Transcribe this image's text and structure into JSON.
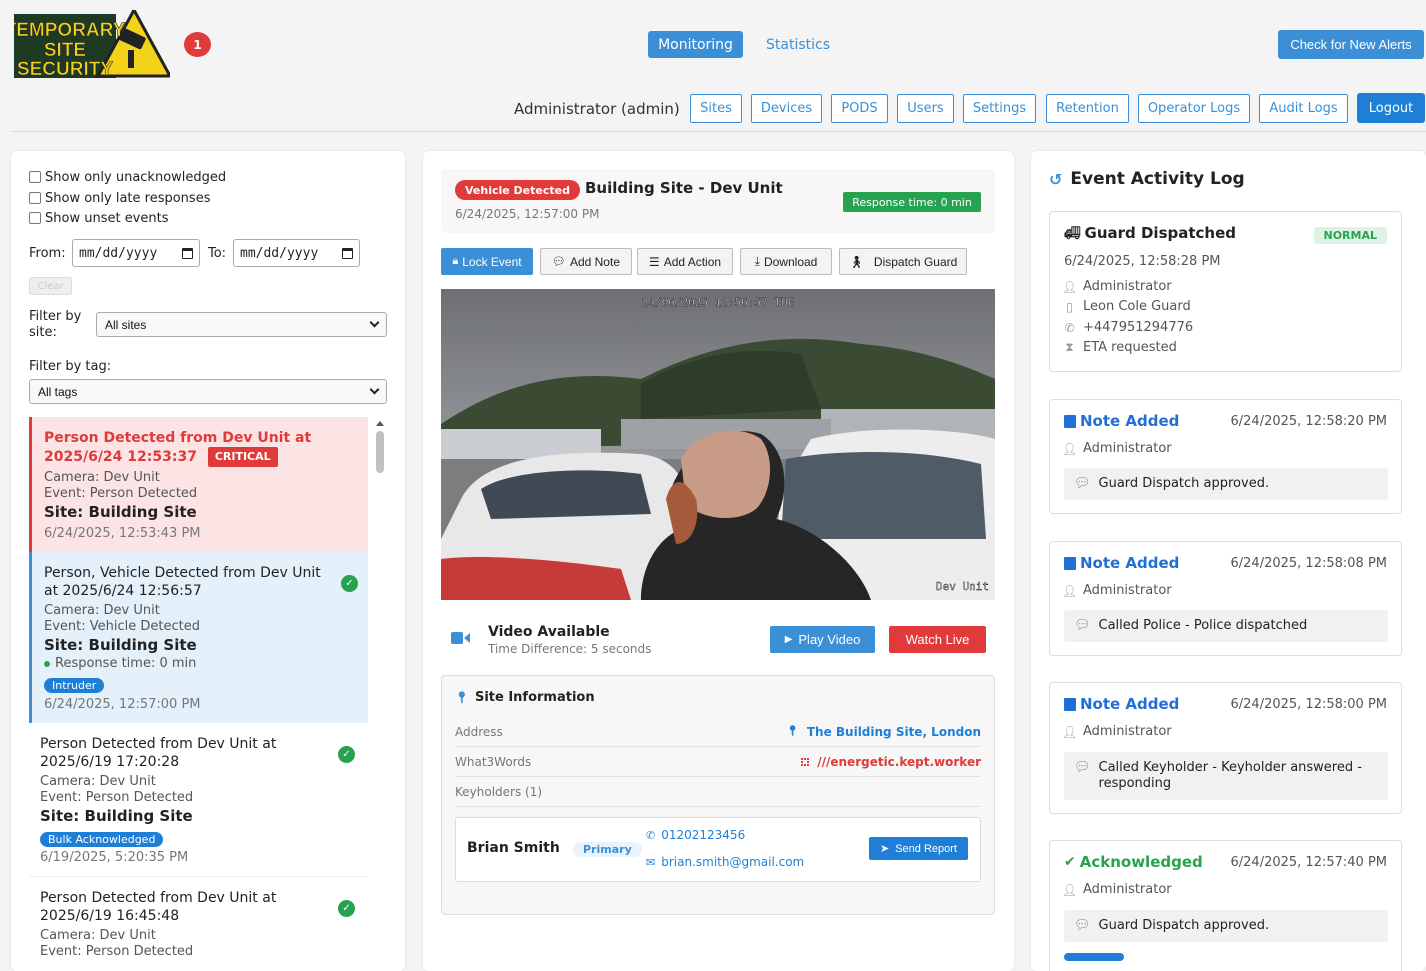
{
  "header": {
    "logo_lines": [
      "TEMPORARY",
      "SITE",
      "SECURITY"
    ],
    "notification_count": "1",
    "tabs": {
      "monitoring": "Monitoring",
      "statistics": "Statistics"
    },
    "check_alerts": "Check for New Alerts",
    "user_label": "Administrator (admin)",
    "nav": {
      "sites": "Sites",
      "devices": "Devices",
      "pods": "PODS",
      "users": "Users",
      "settings": "Settings",
      "retention": "Retention",
      "operator_logs": "Operator Logs",
      "audit_logs": "Audit Logs",
      "logout": "Logout"
    }
  },
  "filters": {
    "unacknowledged": "Show only unacknowledged",
    "late": "Show only late responses",
    "unset": "Show unset events",
    "from_label": "From:",
    "to_label": "To:",
    "date_placeholder": "mm/dd/yyyy",
    "clear": "Clear",
    "site_label": "Filter by site:",
    "site_value": "All sites",
    "tag_label": "Filter by tag:",
    "tag_value": "All tags"
  },
  "events": [
    {
      "title": "Person Detected from Dev Unit at 2025/6/24 12:53:37",
      "severity": "CRITICAL",
      "camera": "Camera: Dev Unit",
      "event": "Event: Person Detected",
      "site": "Site: Building Site",
      "time": "6/24/2025, 12:53:43 PM"
    },
    {
      "title": "Person, Vehicle Detected from Dev Unit at 2025/6/24 12:56:57",
      "camera": "Camera: Dev Unit",
      "event": "Event: Vehicle Detected",
      "site": "Site: Building Site",
      "response": "Response time: 0 min",
      "tag": "Intruder",
      "time": "6/24/2025, 12:57:00 PM"
    },
    {
      "title": "Person Detected from Dev Unit at 2025/6/19 17:20:28",
      "camera": "Camera: Dev Unit",
      "event": "Event: Person Detected",
      "site": "Site: Building Site",
      "tag": "Bulk Acknowledged",
      "time": "6/19/2025, 5:20:35 PM"
    },
    {
      "title": "Person Detected from Dev Unit at 2025/6/19 16:45:48",
      "camera": "Camera: Dev Unit",
      "event": "Event: Person Detected"
    }
  ],
  "detail": {
    "badge": "Vehicle Detected",
    "title": "Building Site - Dev Unit",
    "date": "6/24/2025, 12:57:00 PM",
    "response": "Response time: 0 min",
    "actions": {
      "lock": "Lock Event",
      "note": "Add Note",
      "action": "Add Action",
      "download": "Download",
      "dispatch": "Dispatch Guard"
    },
    "camera": {
      "timestamp": "24/06/2025 12:56:57 TUE",
      "label": "Dev Unit"
    },
    "video": {
      "title": "Video Available",
      "diff": "Time Difference: 5 seconds",
      "play": "Play Video",
      "live": "Watch Live"
    },
    "site_info": {
      "title": "Site Information",
      "address_label": "Address",
      "address": "The Building Site, London",
      "w3w_label": "What3Words",
      "w3w": "///energetic.kept.worker",
      "keyholders_label": "Keyholders (1)",
      "keyholder": {
        "name": "Brian Smith",
        "role": "Primary",
        "phone": "01202123456",
        "email": "brian.smith@gmail.com",
        "send": "Send Report"
      }
    }
  },
  "log": {
    "title": "Event Activity Log",
    "entries": [
      {
        "title": "Guard Dispatched",
        "badge": "NORMAL",
        "date": "6/24/2025, 12:58:28 PM",
        "lines": [
          "Administrator",
          "Leon Cole Guard",
          "+447951294776",
          "ETA requested"
        ]
      },
      {
        "title": "Note Added",
        "date": "6/24/2025, 12:58:20 PM",
        "user": "Administrator",
        "note": "Guard Dispatch approved."
      },
      {
        "title": "Note Added",
        "date": "6/24/2025, 12:58:08 PM",
        "user": "Administrator",
        "note": "Called Police - Police dispatched"
      },
      {
        "title": "Note Added",
        "date": "6/24/2025, 12:58:00 PM",
        "user": "Administrator",
        "note": "Called Keyholder - Keyholder answered - responding"
      },
      {
        "title": "Acknowledged",
        "date": "6/24/2025, 12:57:40 PM",
        "user": "Administrator",
        "note": "Guard Dispatch approved."
      }
    ]
  },
  "colors": {
    "primary": "#3a8fd6",
    "danger": "#e03a3a",
    "success": "#27a350",
    "critical_bg": "#fde4e4",
    "selected_bg": "#e4f0fa"
  }
}
